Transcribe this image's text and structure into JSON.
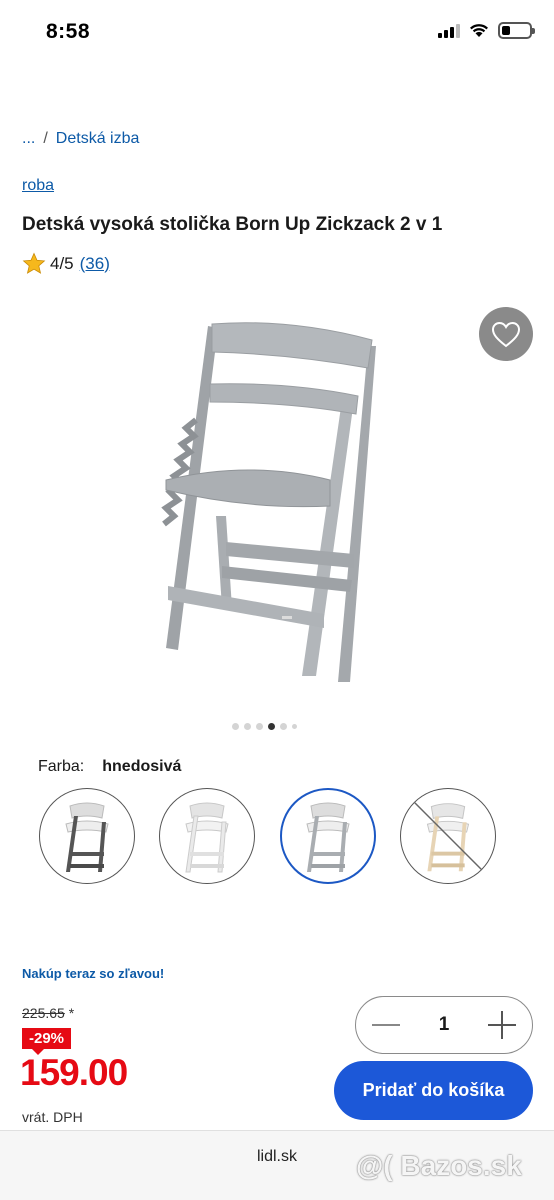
{
  "status_bar": {
    "time": "8:58"
  },
  "breadcrumb": {
    "ellipsis": "...",
    "separator": "/",
    "current": "Detská izba"
  },
  "product": {
    "brand": "roba",
    "title": "Detská vysoká stolička Born Up Zickzack 2 v 1",
    "rating": "4/5",
    "review_count": "(36)"
  },
  "gallery": {
    "image_count": 6,
    "active_index": 3
  },
  "color": {
    "label": "Farba:",
    "value": "hnedosivá",
    "selected_index": 2
  },
  "pricing": {
    "promo_text": "Nakúp teraz so zľavou!",
    "old_price": "225.65",
    "old_price_marker": "*",
    "discount": "-29%",
    "price": "159.00",
    "vat_note": "vrát. DPH"
  },
  "cart": {
    "quantity": "1",
    "add_label": "Pridať do košíka"
  },
  "footer": {
    "domain": "lidl.sk",
    "watermark": "@( Bazos.sk"
  },
  "colors": {
    "link": "#0d5aa7",
    "price_red": "#e60a14",
    "button_blue": "#1c58d8",
    "chair_gray": "#a9adb1"
  }
}
